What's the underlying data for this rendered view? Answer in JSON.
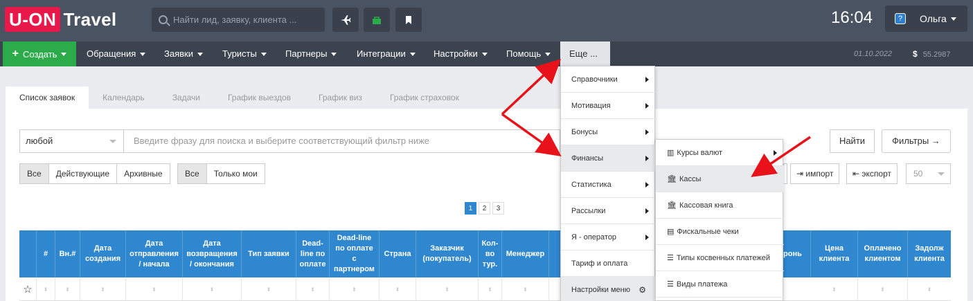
{
  "header": {
    "logo_badge": "U-ON",
    "logo_text": "Travel",
    "search_placeholder": "Найти лид, заявку, клиента ...",
    "clock": "16:04",
    "help_icon": "?",
    "user_name": "Ольга"
  },
  "nav": {
    "create": "Создать",
    "items": [
      "Обращения",
      "Заявки",
      "Туристы",
      "Партнеры",
      "Интеграции",
      "Настройки",
      "Помощь"
    ],
    "more": "Еще ...",
    "date": "01.10.2022",
    "currency_symbol": "$",
    "rate": "55.2987"
  },
  "tabs": [
    "Список заявок",
    "Календарь",
    "Задачи",
    "График выездов",
    "График виз",
    "График страховок"
  ],
  "filters": {
    "select_value": "любой",
    "phrase_placeholder": "Введите фразу для поиска и выберите соответствующий фильтр ниже",
    "find": "Найти",
    "filters": "Фильтры →",
    "status_group": [
      "Все",
      "Действующие",
      "Архивные"
    ],
    "owner_group": [
      "Все",
      "Только мои"
    ],
    "import": "импорт",
    "export": "экспорт",
    "per_page": "50"
  },
  "pagination": [
    "1",
    "2",
    "3"
  ],
  "table": {
    "headers": [
      "#",
      "Вн.#",
      "Дата создания",
      "Дата отправления / начала",
      "Дата возвращения / окончания",
      "Тип заявки",
      "Dead-line по оплате",
      "Dead-line по оплате с партнером",
      "Страна",
      "Заказчик (покупатель)",
      "Кол-во тур.",
      "Менеджер",
      "ронь",
      "Цена клиента",
      "Оплачено клиентом",
      "Задолж клиента"
    ]
  },
  "dropdown": {
    "items": [
      "Справочники",
      "Мотивация",
      "Бонусы",
      "Финансы",
      "Статистика",
      "Рассылки",
      "Я - оператор",
      "Тариф и оплата",
      "Настройки меню"
    ]
  },
  "submenu": {
    "items": [
      "Курсы валют",
      "Кассы",
      "Кассовая книга",
      "Фискальные чеки",
      "Типы косвенных платежей",
      "Виды платежа"
    ]
  },
  "colors": {
    "brand": "#e8184a",
    "create": "#2bab4a",
    "header": "#4a5361",
    "table_head": "#2f87d0",
    "annotation": "#e8131a"
  }
}
